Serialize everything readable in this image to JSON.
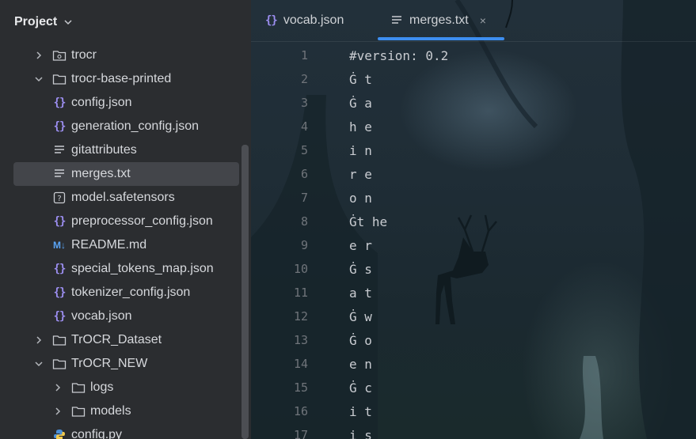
{
  "sidebar": {
    "title": "Project",
    "items": [
      {
        "label": "trocr",
        "type": "folder-special",
        "depth": 0,
        "arrow": "right"
      },
      {
        "label": "trocr-base-printed",
        "type": "folder",
        "depth": 0,
        "arrow": "down"
      },
      {
        "label": "config.json",
        "type": "json",
        "depth": 1
      },
      {
        "label": "generation_config.json",
        "type": "json",
        "depth": 1
      },
      {
        "label": "gitattributes",
        "type": "text",
        "depth": 1
      },
      {
        "label": "merges.txt",
        "type": "text",
        "depth": 1,
        "selected": true
      },
      {
        "label": "model.safetensors",
        "type": "unknown",
        "depth": 1
      },
      {
        "label": "preprocessor_config.json",
        "type": "json",
        "depth": 1
      },
      {
        "label": "README.md",
        "type": "markdown",
        "depth": 1
      },
      {
        "label": "special_tokens_map.json",
        "type": "json",
        "depth": 1
      },
      {
        "label": "tokenizer_config.json",
        "type": "json",
        "depth": 1
      },
      {
        "label": "vocab.json",
        "type": "json",
        "depth": 1
      },
      {
        "label": "TrOCR_Dataset",
        "type": "folder",
        "depth": 0,
        "arrow": "right"
      },
      {
        "label": "TrOCR_NEW",
        "type": "folder",
        "depth": 0,
        "arrow": "down"
      },
      {
        "label": "logs",
        "type": "folder",
        "depth": 1,
        "arrow": "right"
      },
      {
        "label": "models",
        "type": "folder",
        "depth": 1,
        "arrow": "right"
      },
      {
        "label": "config.py",
        "type": "python",
        "depth": 1
      }
    ]
  },
  "icons": {
    "json": "json-braces-icon",
    "text": "text-file-icon",
    "unknown": "unknown-file-icon",
    "markdown": "markdown-icon",
    "folder": "folder-icon",
    "python": "python-icon"
  },
  "md_icon_text": "M↓",
  "json_icon_text": "{}",
  "unknown_icon_text": "?",
  "tabs": [
    {
      "label": "vocab.json",
      "icon": "json-braces-icon",
      "active": false
    },
    {
      "label": "merges.txt",
      "icon": "text-file-icon",
      "active": true,
      "close": "×"
    }
  ],
  "editor": {
    "lines": [
      {
        "n": "1",
        "text": "#version: 0.2"
      },
      {
        "n": "2",
        "text": "Ġ t"
      },
      {
        "n": "3",
        "text": "Ġ a"
      },
      {
        "n": "4",
        "text": "h e"
      },
      {
        "n": "5",
        "text": "i n"
      },
      {
        "n": "6",
        "text": "r e"
      },
      {
        "n": "7",
        "text": "o n"
      },
      {
        "n": "8",
        "text": "Ġt he"
      },
      {
        "n": "9",
        "text": "e r"
      },
      {
        "n": "10",
        "text": "Ġ s"
      },
      {
        "n": "11",
        "text": "a t"
      },
      {
        "n": "12",
        "text": "Ġ w"
      },
      {
        "n": "13",
        "text": "Ġ o"
      },
      {
        "n": "14",
        "text": "e n"
      },
      {
        "n": "15",
        "text": "Ġ c"
      },
      {
        "n": "16",
        "text": "i t"
      },
      {
        "n": "17",
        "text": "i s"
      }
    ]
  },
  "colors": {
    "sidebar_bg": "#2b2d30",
    "selected_row": "#43454a",
    "accent": "#3d8ef0",
    "json_icon": "#9c8ef0"
  }
}
